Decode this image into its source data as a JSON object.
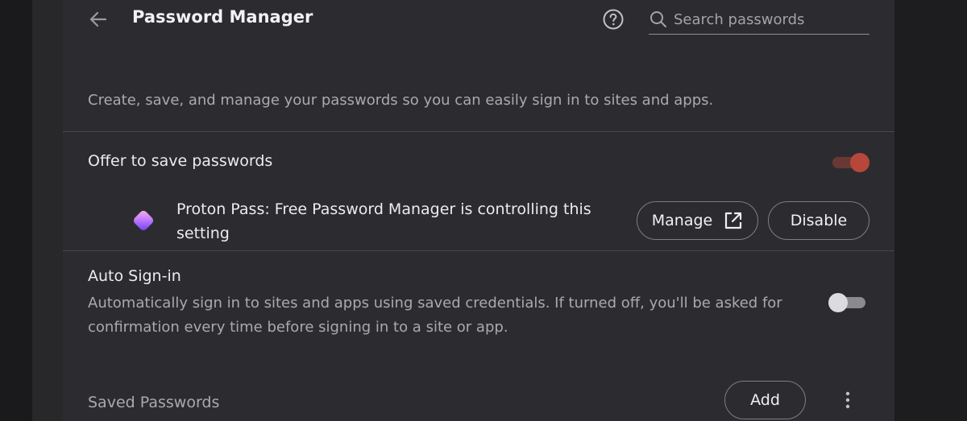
{
  "header": {
    "title": "Password Manager",
    "search_placeholder": "Search passwords",
    "search_value": ""
  },
  "description": "Create, save, and manage your passwords so you can easily sign in to sites and apps.",
  "offer_save": {
    "label": "Offer to save passwords",
    "enabled": true
  },
  "extension": {
    "message": "Proton Pass: Free Password Manager is controlling this setting",
    "manage_label": "Manage",
    "disable_label": "Disable"
  },
  "auto_signin": {
    "title": "Auto Sign-in",
    "description": "Automatically sign in to sites and apps using saved credentials. If turned off, you'll be asked for confirmation every time before signing in to a site or app.",
    "enabled": false
  },
  "saved_passwords": {
    "label": "Saved Passwords",
    "add_label": "Add"
  },
  "icons": {
    "back": "back-arrow-icon",
    "help": "help-icon",
    "search": "search-icon",
    "extension": "proton-pass-icon",
    "open": "open-in-new-icon",
    "more": "more-vert-icon"
  },
  "colors": {
    "background": "#2c2c30",
    "toggle_on_thumb": "#b7473a",
    "toggle_on_track": "#6a3834",
    "toggle_off_thumb": "#dcdce0",
    "toggle_off_track": "#8a8a8f"
  }
}
